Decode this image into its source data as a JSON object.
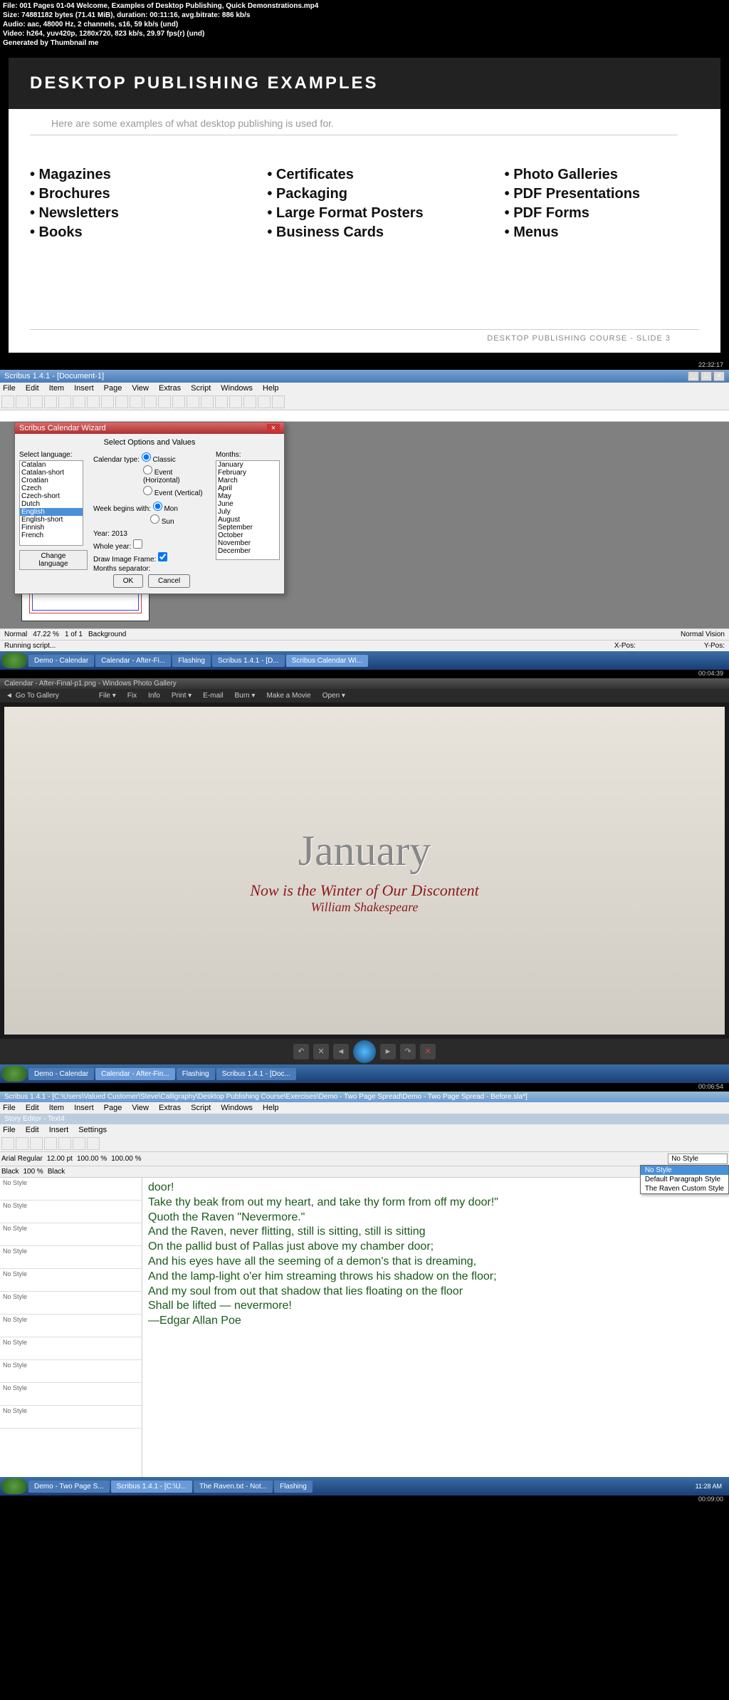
{
  "meta": {
    "file": "File: 001 Pages 01-04 Welcome, Examples of Desktop Publishing, Quick Demonstrations.mp4",
    "size": "Size: 74881182 bytes (71.41 MiB), duration: 00:11:16, avg.bitrate: 886 kb/s",
    "audio": "Audio: aac, 48000 Hz, 2 channels, s16, 59 kb/s (und)",
    "video": "Video: h264, yuv420p, 1280x720, 823 kb/s, 29.97 fps(r) (und)",
    "gen": "Generated by Thumbnail me"
  },
  "slide": {
    "title": "DESKTOP PUBLISHING EXAMPLES",
    "subtitle": "Here are some examples of what desktop publishing is used for.",
    "col1": [
      "• Magazines",
      "• Brochures",
      "• Newsletters",
      "• Books"
    ],
    "col2": [
      "• Certificates",
      "• Packaging",
      "• Large Format Posters",
      "• Business Cards"
    ],
    "col3": [
      "• Photo Galleries",
      "• PDF Presentations",
      "• PDF Forms",
      "• Menus"
    ],
    "footer": "DESKTOP PUBLISHING COURSE - SLIDE 3",
    "tc": "22:32:17"
  },
  "scribus": {
    "title": "Scribus 1.4.1 - [Document-1]",
    "menu": [
      "File",
      "Edit",
      "Item",
      "Insert",
      "Page",
      "View",
      "Extras",
      "Script",
      "Windows",
      "Help"
    ],
    "dialog": {
      "title": "Scribus Calendar Wizard",
      "header": "Select Options and Values",
      "lang_label": "Select language:",
      "langs": [
        "Catalan",
        "Catalan-short",
        "Croatian",
        "Czech",
        "Czech-short",
        "Dutch",
        "English",
        "English-short",
        "Finnish",
        "French"
      ],
      "sel_lang": "English",
      "change_lang": "Change language",
      "cal_type": "Calendar type:",
      "classic": "Classic",
      "evh": "Event (Horizontal)",
      "evv": "Event (Vertical)",
      "week": "Week begins with:",
      "mon": "Mon",
      "sun": "Sun",
      "year": "Year: 2013",
      "whole": "Whole year:",
      "frame": "Draw Image Frame:",
      "sep": "Months separator:",
      "months_label": "Months:",
      "months": [
        "January",
        "February",
        "March",
        "April",
        "May",
        "June",
        "July",
        "August",
        "September",
        "October",
        "November",
        "December"
      ],
      "ok": "OK",
      "cancel": "Cancel"
    },
    "status": {
      "normal": "Normal",
      "zoom": "47.22 %",
      "page": "1 of 1",
      "bg": "Background",
      "running": "Running script...",
      "xpos": "X-Pos:",
      "ypos": "Y-Pos:",
      "nv": "Normal Vision"
    },
    "taskbar": [
      "Demo - Calendar",
      "Calendar - After-Fi...",
      "Flashing",
      "Scribus 1.4.1 - [D...",
      "Scribus Calendar Wi..."
    ],
    "tc": "00:04:39"
  },
  "pv": {
    "title": "Calendar - After-Final-p1.png - Windows Photo Gallery",
    "back": "Go To Gallery",
    "menu": [
      "File ▾",
      "Fix",
      "Info",
      "Print ▾",
      "E-mail",
      "Burn ▾",
      "Make a Movie",
      "Open ▾"
    ],
    "month": "January",
    "quote": "Now is the Winter of Our Discontent",
    "author": "William Shakespeare",
    "taskbar": [
      "Demo - Calendar",
      "Calendar - After-Fin...",
      "Flashing",
      "Scribus 1.4.1 - [Doc..."
    ],
    "tc": "00:06:54"
  },
  "se": {
    "title": "Scribus 1.4.1 - [C:\\Users\\Valued Customer\\Steve\\Calligraphy\\Desktop Publishing Course\\Exercises\\Demo - Two Page Spread\\Demo - Two Page Spread - Before.sla*]",
    "subtitle": "Story Editor - Text4",
    "menu": [
      "File",
      "Edit",
      "Insert",
      "Settings"
    ],
    "font": "Arial Regular",
    "size": "12.00 pt",
    "scale": "100.00 %",
    "black": "Black",
    "shade": "100 %",
    "dropdown": [
      "No Style",
      "Default Paragraph Style",
      "The Raven Custom Style"
    ],
    "nostyle": "No Style",
    "lines": [
      "door!",
      "Take thy beak from out my heart, and take thy form from off my door!\"",
      "            Quoth the Raven \"Nevermore.\"",
      "",
      "And the Raven, never flitting, still is sitting, still is sitting",
      "On the pallid bust of Pallas just above my chamber door;",
      "And his eyes have all the seeming of a demon's that is dreaming,",
      "And the lamp-light o'er him streaming throws his shadow on the floor;",
      "And my soul from out that shadow that lies floating on the floor",
      "            Shall be lifted — nevermore!",
      "—Edgar Allan Poe"
    ],
    "taskbar": [
      "Demo - Two Page S...",
      "Scribus 1.4.1 - [C:\\U...",
      "The Raven.txt - Not...",
      "Flashing"
    ],
    "clock": "11:28 AM",
    "tc": "00:09:00"
  }
}
